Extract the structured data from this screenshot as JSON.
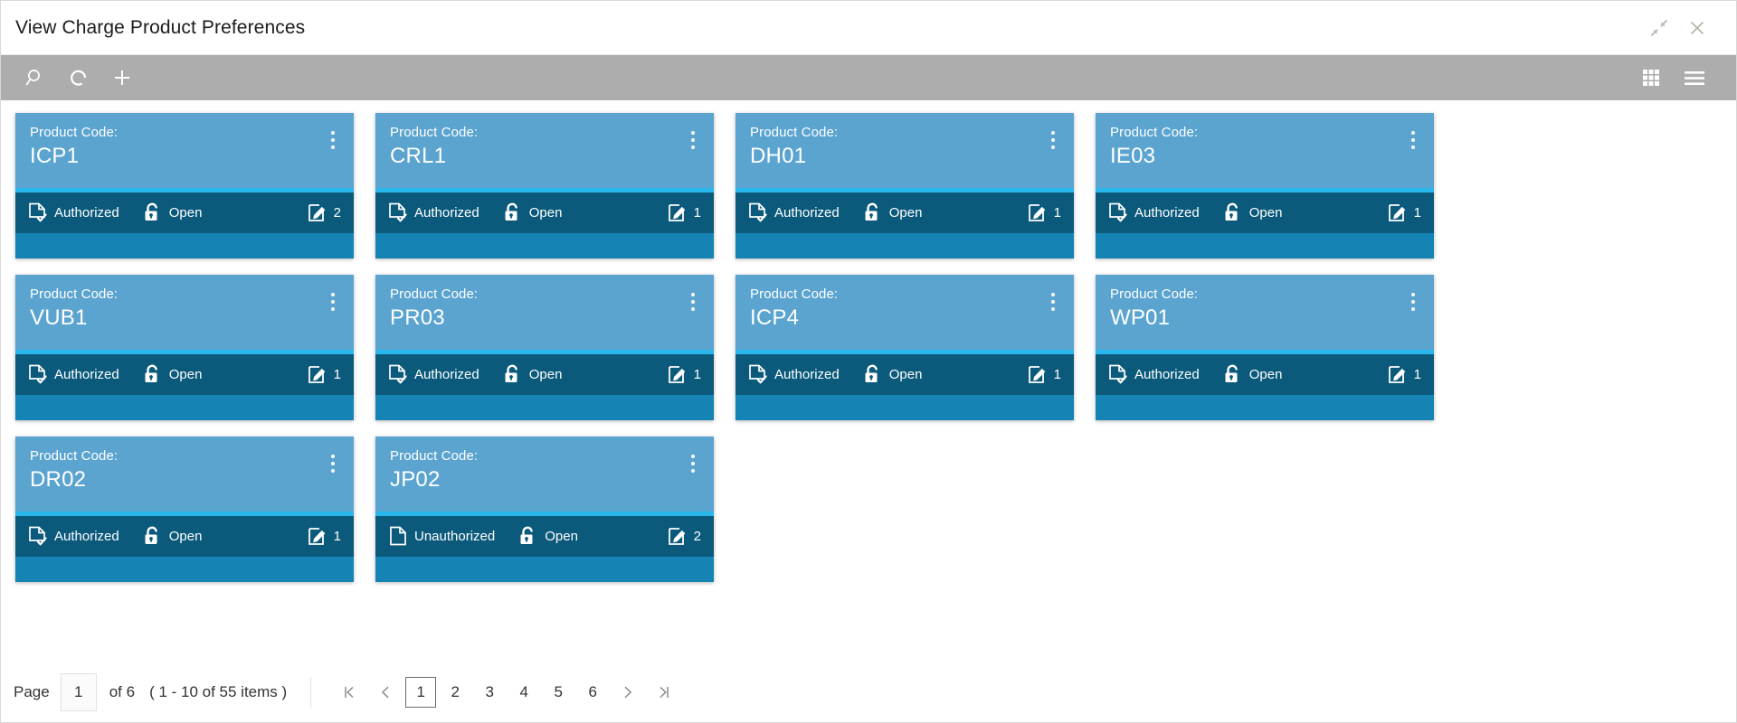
{
  "window": {
    "title": "View Charge Product Preferences",
    "minimize_icon": "collapse-arrows-icon",
    "close_icon": "close-icon"
  },
  "toolbar": {
    "search_icon": "search-icon",
    "refresh_icon": "refresh-icon",
    "add_icon": "plus-icon",
    "tile_view_icon": "grid-view-icon",
    "list_view_icon": "hamburger-menu-icon"
  },
  "card_labels": {
    "product_code": "Product Code:",
    "menu_icon": "kebab-menu-icon",
    "auth_icon": "document-check-icon",
    "unauth_icon": "document-icon",
    "lock_icon": "unlock-icon",
    "edit_icon": "edit-square-icon"
  },
  "colors": {
    "card_header": "#5ba4d0",
    "card_divider": "#29b6ea",
    "card_footer": "#0b5a7c",
    "card_body": "#1683b5",
    "toolbar": "#adadad"
  },
  "cards": [
    {
      "code": "ICP1",
      "auth_status": "Authorized",
      "lock_status": "Open",
      "count": "2"
    },
    {
      "code": "CRL1",
      "auth_status": "Authorized",
      "lock_status": "Open",
      "count": "1"
    },
    {
      "code": "DH01",
      "auth_status": "Authorized",
      "lock_status": "Open",
      "count": "1"
    },
    {
      "code": "IE03",
      "auth_status": "Authorized",
      "lock_status": "Open",
      "count": "1"
    },
    {
      "code": "VUB1",
      "auth_status": "Authorized",
      "lock_status": "Open",
      "count": "1"
    },
    {
      "code": "PR03",
      "auth_status": "Authorized",
      "lock_status": "Open",
      "count": "1"
    },
    {
      "code": "ICP4",
      "auth_status": "Authorized",
      "lock_status": "Open",
      "count": "1"
    },
    {
      "code": "WP01",
      "auth_status": "Authorized",
      "lock_status": "Open",
      "count": "1"
    },
    {
      "code": "DR02",
      "auth_status": "Authorized",
      "lock_status": "Open",
      "count": "1"
    },
    {
      "code": "JP02",
      "auth_status": "Unauthorized",
      "lock_status": "Open",
      "count": "2"
    }
  ],
  "pagination": {
    "page_label": "Page",
    "page_value": "1",
    "of_text": "of 6",
    "items_text": "( 1 - 10 of 55 items )",
    "pages": [
      "1",
      "2",
      "3",
      "4",
      "5",
      "6"
    ],
    "active_page": "1",
    "first_icon": "first-page-icon",
    "prev_icon": "previous-page-icon",
    "next_icon": "next-page-icon",
    "last_icon": "last-page-icon"
  }
}
